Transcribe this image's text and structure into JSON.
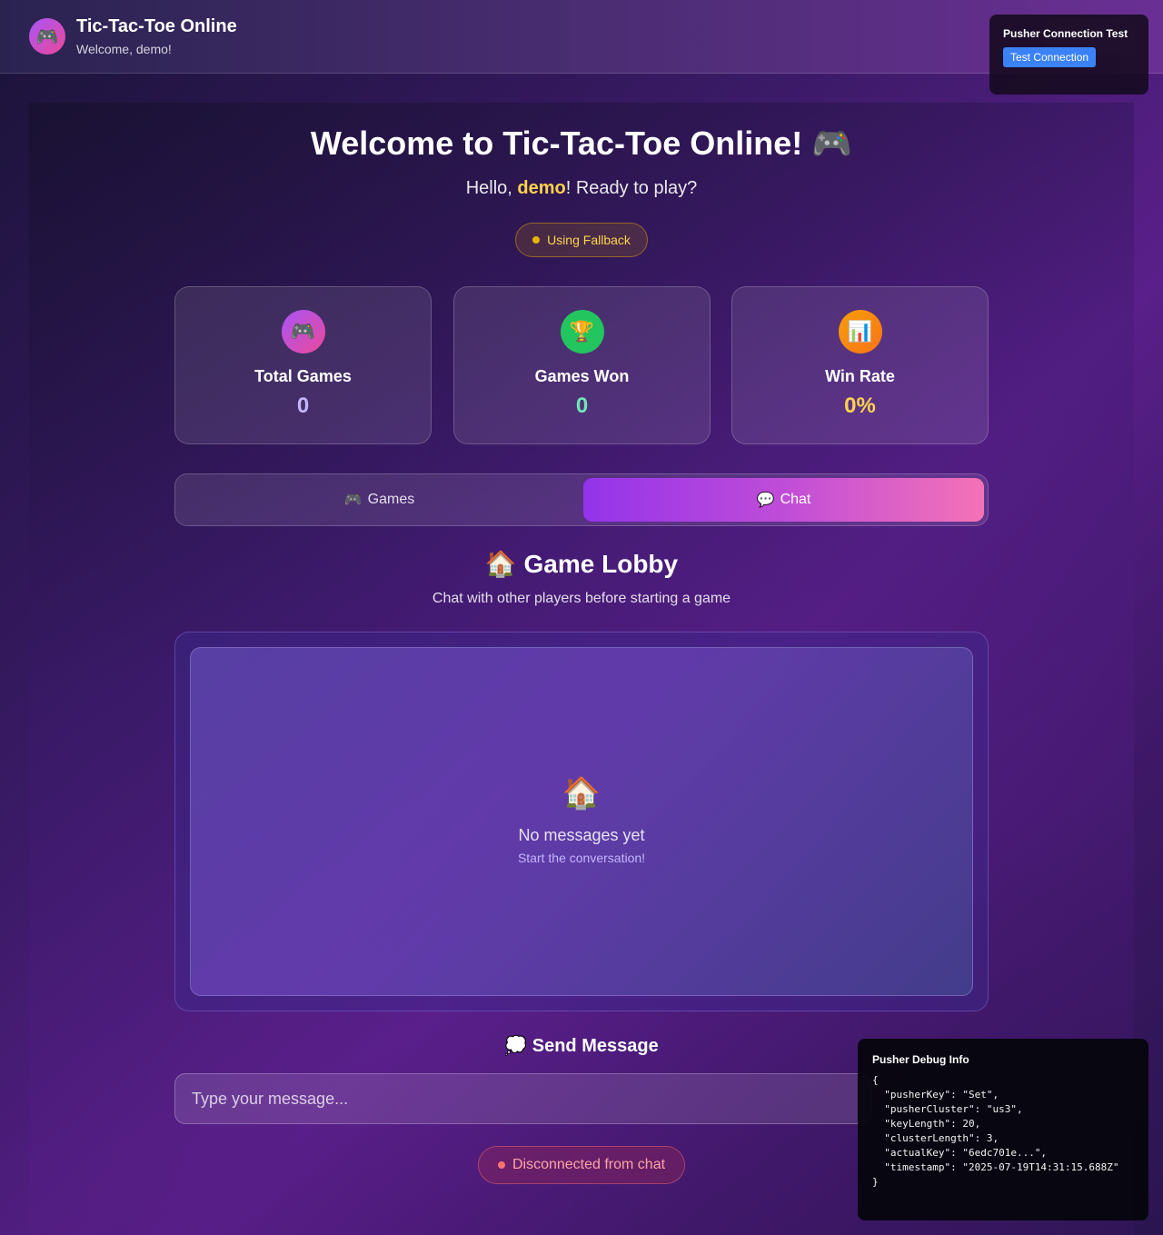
{
  "header": {
    "logo_icon": "🎮",
    "title": "Tic-Tac-Toe Online",
    "subtitle": "Welcome, demo!"
  },
  "pusher_test": {
    "title": "Pusher Connection Test",
    "button_label": "Test Connection"
  },
  "hero": {
    "title": "Welcome to Tic-Tac-Toe Online! 🎮",
    "hello_prefix": "Hello, ",
    "username": "demo",
    "hello_suffix": "! Ready to play?",
    "status_badge": "Using Fallback"
  },
  "stats": [
    {
      "icon": "🎮",
      "label": "Total Games",
      "value": "0",
      "value_color": "#c4b5fd",
      "icon_bg": "linear-gradient(135deg,#a855f7,#ec4899)"
    },
    {
      "icon": "🏆",
      "label": "Games Won",
      "value": "0",
      "value_color": "#6ee7b7",
      "icon_bg": "#22c55e"
    },
    {
      "icon": "📊",
      "label": "Win Rate",
      "value": "0%",
      "value_color": "#fcd34d",
      "icon_bg": "linear-gradient(135deg,#f59e0b,#f97316)"
    }
  ],
  "tabs": {
    "games_icon": "🎮",
    "games_label": "Games",
    "chat_icon": "💬",
    "chat_label": "Chat",
    "active": "Chat"
  },
  "lobby": {
    "title": "🏠 Game Lobby",
    "subtitle": "Chat with other players before starting a game",
    "empty_icon": "🏠",
    "empty_title": "No messages yet",
    "empty_subtitle": "Start the conversation!"
  },
  "send": {
    "title": "💭 Send Message",
    "placeholder": "Type your message...",
    "value": ""
  },
  "chat_status": "Disconnected from chat",
  "debug": {
    "title": "Pusher Debug Info",
    "json_text": "{\n  \"pusherKey\": \"Set\",\n  \"pusherCluster\": \"us3\",\n  \"keyLength\": 20,\n  \"clusterLength\": 3,\n  \"actualKey\": \"6edc701e...\",\n  \"timestamp\": \"2025-07-19T14:31:15.688Z\"\n}"
  },
  "colors": {
    "accent_yellow": "#fcd34d",
    "status_fallback_dot": "#eab308",
    "status_disconnected_dot": "#f87171",
    "button_blue": "#3b82f6"
  }
}
